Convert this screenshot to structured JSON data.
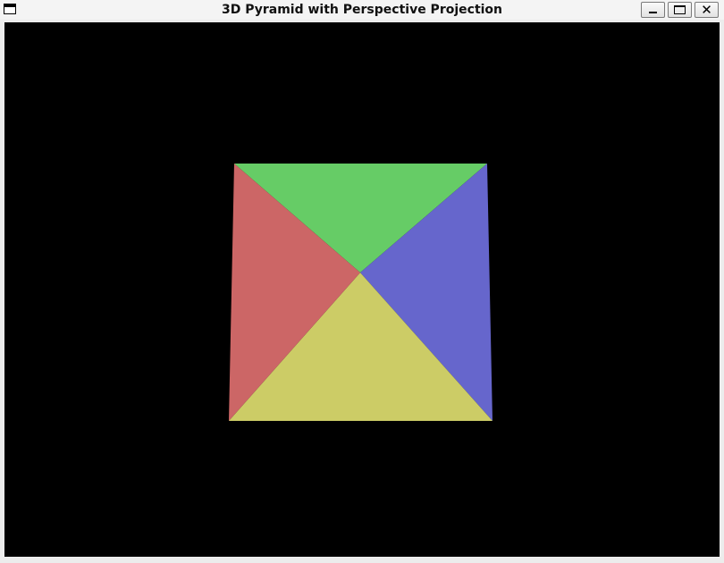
{
  "window": {
    "title": "3D Pyramid with Perspective Projection",
    "icon": "window-icon",
    "controls": {
      "minimize_icon": "minimize-icon",
      "maximize_icon": "maximize-icon",
      "close_icon": "close-icon",
      "close_glyph": "✕"
    }
  },
  "scene": {
    "background_color": "#000000",
    "faces": [
      {
        "name": "top-face",
        "color": "#66cc66"
      },
      {
        "name": "right-face",
        "color": "#6666cc"
      },
      {
        "name": "bottom-face",
        "color": "#cccc66"
      },
      {
        "name": "left-face",
        "color": "#cc6666"
      }
    ]
  }
}
